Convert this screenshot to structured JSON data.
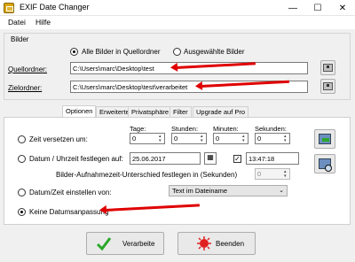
{
  "window": {
    "title": "EXIF Date Changer",
    "minimize": "—",
    "maximize": "☐",
    "close": "✕"
  },
  "menu": {
    "items": [
      "Datei",
      "Hilfe"
    ]
  },
  "bilder": {
    "group_title": "Bilder",
    "radio_all": "Alle Bilder in Quellordner",
    "radio_selected": "Ausgewählte Bilder",
    "selected_option": "Alle Bilder in Quellordner",
    "source_label": "Quellordner:",
    "source_value": "C:\\Users\\marc\\Desktop\\test",
    "target_label": "Zielordner:",
    "target_value": "C:\\Users\\marc\\Desktop\\test\\verarbeitet"
  },
  "tabs": [
    {
      "label": "Optionen",
      "active": true
    },
    {
      "label": "Erweiterte",
      "active": false
    },
    {
      "label": "Privatsphäre",
      "active": false
    },
    {
      "label": "Filter",
      "active": false
    },
    {
      "label": "Upgrade auf Pro",
      "active": false
    }
  ],
  "options": {
    "shift_label": "Zeit versetzen um:",
    "days_label": "Tage:",
    "hours_label": "Stunden:",
    "minutes_label": "Minuten:",
    "seconds_label": "Sekunden:",
    "days_value": "0",
    "hours_value": "0",
    "minutes_value": "0",
    "seconds_value": "0",
    "set_label": "Datum / Uhrzeit festlegen auf:",
    "date_value": "25.06.2017",
    "time_checked": true,
    "time_value": "13:47:18",
    "interval_label": "Bilder-Aufnahmezeit-Unterschied festlegen in (Sekunden)",
    "interval_value": "0",
    "from_label": "Datum/Zeit einstellen von:",
    "from_dropdown": "Text im Dateiname",
    "none_label": "Keine Datumsanpassung",
    "selected_option": "Keine Datumsanpassung"
  },
  "buttons": {
    "process": "Verarbeite",
    "exit": "Beenden"
  },
  "colors": {
    "annotation_arrow": "#e00000",
    "window_bg": "#f0f0f0"
  }
}
